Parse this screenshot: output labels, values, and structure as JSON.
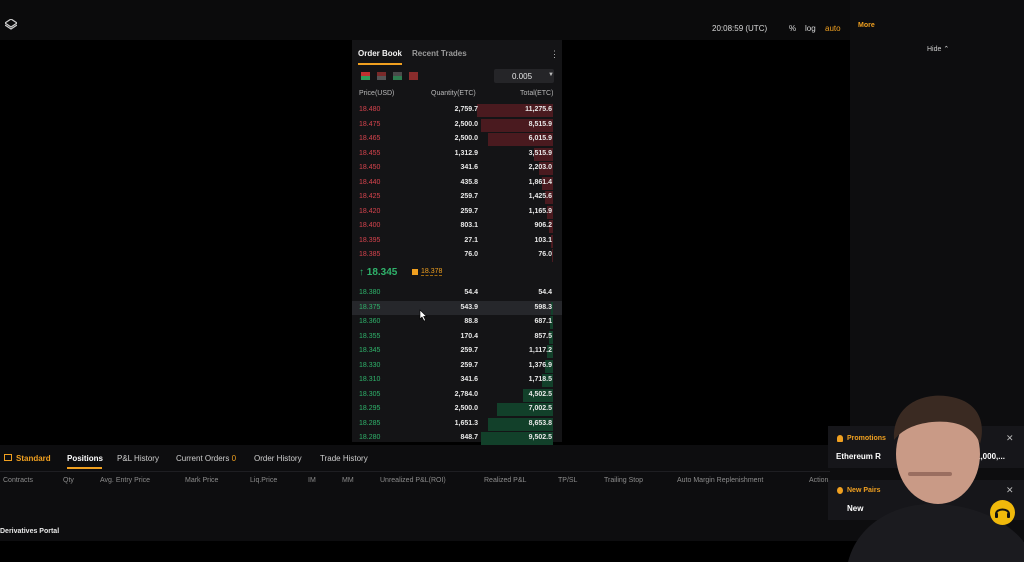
{
  "topbar": {
    "clock": "20:08:59 (UTC)",
    "options": [
      "%",
      "log",
      "auto"
    ],
    "active_option": "auto"
  },
  "right_panel": {
    "more": "More",
    "hide": "Hide"
  },
  "orderbook": {
    "tabs": [
      "Order Book",
      "Recent Trades"
    ],
    "active_tab": "Order Book",
    "tick_size": "0.005",
    "headers": {
      "price": "Price(USD)",
      "quantity": "Quantity(ETC)",
      "total": "Total(ETC)"
    },
    "asks": [
      {
        "price": "18.480",
        "qty": "2,759.7",
        "total": "11,275.6",
        "depth": 1.0
      },
      {
        "price": "18.475",
        "qty": "2,500.0",
        "total": "8,515.9",
        "depth": 0.95
      },
      {
        "price": "18.465",
        "qty": "2,500.0",
        "total": "6,015.9",
        "depth": 0.85
      },
      {
        "price": "18.455",
        "qty": "1,312.9",
        "total": "3,515.9",
        "depth": 0.25
      },
      {
        "price": "18.450",
        "qty": "341.6",
        "total": "2,203.0",
        "depth": 0.18
      },
      {
        "price": "18.440",
        "qty": "435.8",
        "total": "1,861.4",
        "depth": 0.14
      },
      {
        "price": "18.425",
        "qty": "259.7",
        "total": "1,425.6",
        "depth": 0.1
      },
      {
        "price": "18.420",
        "qty": "259.7",
        "total": "1,165.9",
        "depth": 0.08
      },
      {
        "price": "18.400",
        "qty": "803.1",
        "total": "906.2",
        "depth": 0.05
      },
      {
        "price": "18.395",
        "qty": "27.1",
        "total": "103.1",
        "depth": 0.02
      },
      {
        "price": "18.385",
        "qty": "76.0",
        "total": "76.0",
        "depth": 0.01
      }
    ],
    "last_price": "18.345",
    "last_price_direction": "up",
    "mark_price": "18.378",
    "bids": [
      {
        "price": "18.380",
        "qty": "54.4",
        "total": "54.4",
        "depth": 0.0
      },
      {
        "price": "18.375",
        "qty": "543.9",
        "total": "598.3",
        "depth": 0.03
      },
      {
        "price": "18.360",
        "qty": "88.8",
        "total": "687.1",
        "depth": 0.04
      },
      {
        "price": "18.355",
        "qty": "170.4",
        "total": "857.5",
        "depth": 0.05
      },
      {
        "price": "18.345",
        "qty": "259.7",
        "total": "1,117.2",
        "depth": 0.08
      },
      {
        "price": "18.330",
        "qty": "259.7",
        "total": "1,376.9",
        "depth": 0.1
      },
      {
        "price": "18.310",
        "qty": "341.6",
        "total": "1,718.5",
        "depth": 0.14
      },
      {
        "price": "18.305",
        "qty": "2,784.0",
        "total": "4,502.5",
        "depth": 0.4
      },
      {
        "price": "18.295",
        "qty": "2,500.0",
        "total": "7,002.5",
        "depth": 0.74
      },
      {
        "price": "18.285",
        "qty": "1,651.3",
        "total": "8,653.8",
        "depth": 0.85
      },
      {
        "price": "18.280",
        "qty": "848.7",
        "total": "9,502.5",
        "depth": 0.95
      }
    ],
    "highlighted_bid_index": 1
  },
  "bottom": {
    "tabs": [
      {
        "label": "Standard"
      },
      {
        "label": "Positions"
      },
      {
        "label": "P&L History"
      },
      {
        "label": "Current Orders",
        "badge": "0"
      },
      {
        "label": "Order History"
      },
      {
        "label": "Trade History"
      }
    ],
    "active_tab": "Positions",
    "columns": [
      "Contracts",
      "Qty",
      "Avg. Entry Price",
      "Mark Price",
      "Liq.Price",
      "IM",
      "MM",
      "Unrealized P&L(ROI)",
      "Realized P&L",
      "TP/SL",
      "Trailing Stop",
      "Auto Margin Replenishment",
      "Action"
    ],
    "portal": "Derivatives Portal"
  },
  "notifications": [
    {
      "title": "Promotions",
      "body": "Ethereum R",
      "extra": "1,000,..."
    },
    {
      "title": "New Pairs",
      "body": "New"
    }
  ],
  "colors": {
    "accent": "#f0a020",
    "ask": "#d6434d",
    "bid": "#2fb36b"
  }
}
